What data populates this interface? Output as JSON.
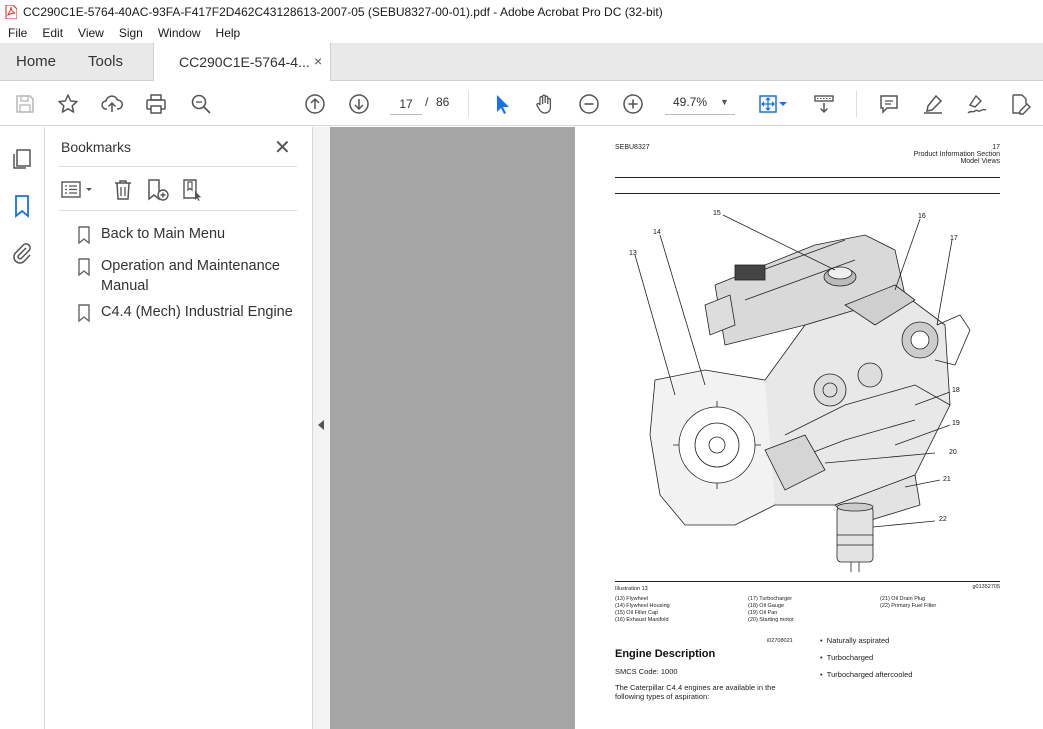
{
  "window": {
    "title": "CC290C1E-5764-40AC-93FA-F417F2D462C43128613-2007-05 (SEBU8327-00-01).pdf - Adobe Acrobat Pro DC (32-bit)"
  },
  "menu": [
    "File",
    "Edit",
    "View",
    "Sign",
    "Window",
    "Help"
  ],
  "tabs": {
    "home": "Home",
    "tools": "Tools",
    "document": "CC290C1E-5764-4...",
    "close": "×"
  },
  "toolbar": {
    "current_page": "17",
    "page_separator": "/",
    "total_pages": "86",
    "zoom": "49.7%",
    "icons": [
      "save-icon",
      "bookmark-star-icon",
      "upload-icon",
      "print-icon",
      "find-icon",
      "page-up-icon",
      "page-down-icon",
      "select-cursor-icon",
      "hand-icon",
      "zoom-out-icon",
      "zoom-in-icon",
      "fit-page-icon",
      "scroll-mode-icon",
      "comment-icon",
      "highlight-icon",
      "sign-icon",
      "edit-pdf-icon"
    ]
  },
  "bookmarks": {
    "title": "Bookmarks",
    "items": [
      {
        "label": "Back to Main Menu"
      },
      {
        "label": "Operation and Maintenance Manual"
      },
      {
        "label": "C4.4 (Mech) Industrial Engine"
      }
    ]
  },
  "page": {
    "header_left": "SEBU8327",
    "header_page_num": "17",
    "header_section": "Product Information Section",
    "header_subsection": "Model Views",
    "illustration_label": "Illustration 13",
    "illustration_id": "g01352705",
    "callouts": [
      "13",
      "14",
      "15",
      "16",
      "17",
      "18",
      "19",
      "20",
      "21",
      "22"
    ],
    "caption_col1": [
      "(13) Flywheel",
      "(14) Flywheel Housing",
      "(15) Oil Filler Cap",
      "(16) Exhaust Manifold"
    ],
    "caption_col2": [
      "(17) Turbocharger",
      "(18) Oil Gauge",
      "(19) Oil Pan",
      "(20) Starting motor"
    ],
    "caption_col3": [
      "(21) Oil Drain Plug",
      "(22) Primary Fuel Filter"
    ],
    "ref_id": "i02708021",
    "section_title": "Engine Description",
    "smcs": "SMCS Code: 1000",
    "body": "The Caterpillar C4.4 engines are available in the following types of aspiration:",
    "bullets": [
      "Naturally aspirated",
      "Turbocharged",
      "Turbocharged aftercooled"
    ]
  }
}
